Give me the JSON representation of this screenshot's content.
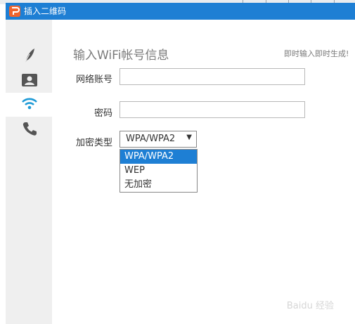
{
  "window": {
    "title": "插入二维码"
  },
  "sidebar": {
    "items": [
      {
        "name": "text",
        "icon": "feather-icon"
      },
      {
        "name": "contact",
        "icon": "contact-card-icon"
      },
      {
        "name": "wifi",
        "icon": "wifi-icon",
        "active": true
      },
      {
        "name": "phone",
        "icon": "phone-icon"
      }
    ]
  },
  "form": {
    "heading": "输入WiFi帐号信息",
    "hint": "即时输入即时生成!",
    "account_label": "网络账号",
    "account_value": "",
    "password_label": "密码",
    "password_value": "",
    "encryption_label": "加密类型",
    "encryption_selected": "WPA/WPA2",
    "encryption_options": [
      "WPA/WPA2",
      "WEP",
      "无加密"
    ]
  },
  "watermark": "Baidu 经验",
  "colors": {
    "titlebar": "#1e7fd4",
    "sidebar": "#efefef",
    "accent": "#1e9ad6",
    "icon": "#555555"
  }
}
